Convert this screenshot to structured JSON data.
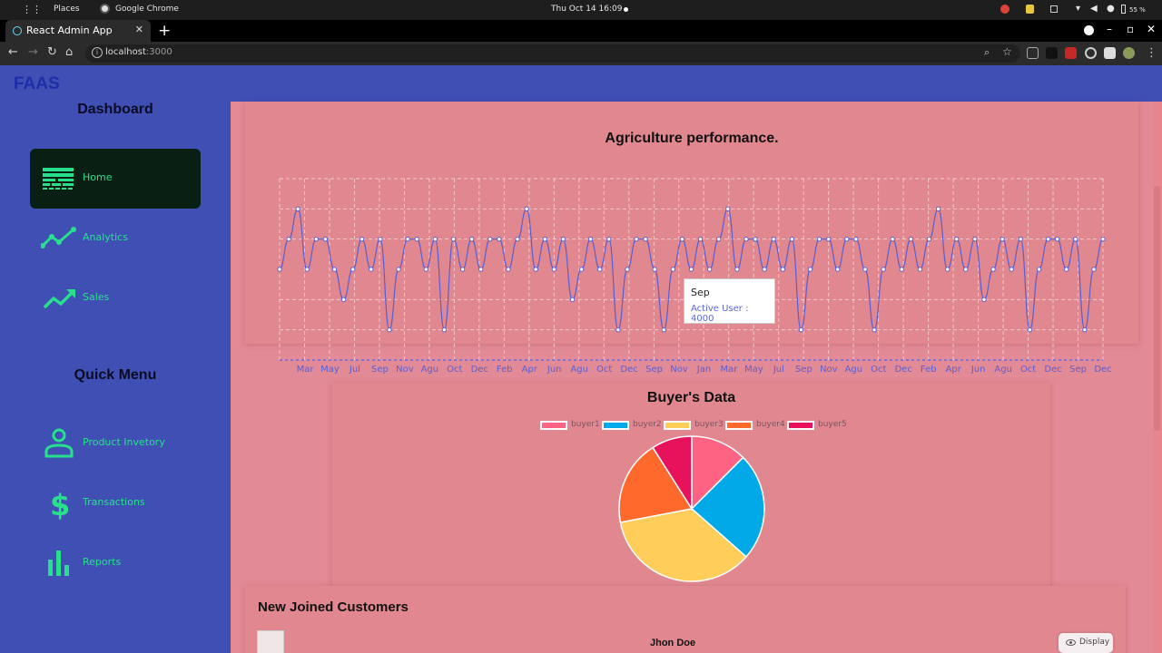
{
  "os_bar": {
    "places": "Places",
    "app_name": "Google Chrome",
    "datetime": "Thu Oct 14  16:09",
    "battery": "55 %"
  },
  "browser": {
    "tab_title": "React Admin App",
    "url_host": "localhost",
    "url_port": ":3000"
  },
  "app": {
    "logo": "FAAS"
  },
  "sidebar": {
    "dashboard_heading": "Dashboard",
    "quick_menu_heading": "Quick Menu",
    "dashboard_items": [
      {
        "label": "Home",
        "icon": "dashboard-icon",
        "active": true
      },
      {
        "label": "Analytics",
        "icon": "timeline-icon",
        "active": false
      },
      {
        "label": "Sales",
        "icon": "trending-up-icon",
        "active": false
      }
    ],
    "quick_items": [
      {
        "label": "Product Invetory",
        "icon": "person-icon"
      },
      {
        "label": "Transactions",
        "icon": "dollar-icon"
      },
      {
        "label": "Reports",
        "icon": "bar-chart-icon"
      }
    ]
  },
  "colors": {
    "sidebar_bg": "#3f4fb4",
    "accent_green": "#28e08c",
    "line_color": "#5b5fd0",
    "page_bg": "#e28a95"
  },
  "chart_data": [
    {
      "type": "line",
      "title": "Agriculture performance.",
      "series": [
        {
          "name": "Active User",
          "values": [
            3000,
            4000,
            5000,
            3000,
            4000,
            4000,
            3000,
            2000,
            3000,
            4000,
            3000,
            4000,
            1000,
            3000,
            4000,
            4000,
            3000,
            4000,
            1000,
            4000,
            3000,
            4000,
            3000,
            4000,
            4000,
            3000,
            4000,
            5000,
            3000,
            4000,
            3000,
            4000,
            2000,
            3000,
            4000,
            3000,
            4000,
            1000,
            3000,
            4000,
            4000,
            3000,
            1000,
            3000,
            4000,
            3000,
            4000,
            3000,
            4000,
            5000,
            3000,
            4000,
            4000,
            3000,
            4000,
            3000,
            4000,
            1000,
            3000,
            4000,
            4000,
            3000,
            4000,
            4000,
            3000,
            1000,
            3000,
            4000,
            3000,
            4000,
            3000,
            4000,
            5000,
            3000,
            4000,
            3000,
            4000,
            2000,
            3000,
            4000,
            3000,
            4000,
            1000,
            3000,
            4000,
            4000,
            3000,
            4000,
            1000,
            3000,
            4000
          ]
        }
      ],
      "x_tick_labels": [
        "Mar",
        "May",
        "Jul",
        "Sep",
        "Nov",
        "Agu",
        "Oct",
        "Dec",
        "Feb",
        "Apr",
        "Jun",
        "Agu",
        "Oct",
        "Dec",
        "Sep",
        "Nov",
        "Jan",
        "Mar",
        "May",
        "Jul",
        "Sep",
        "Nov",
        "Agu",
        "Oct",
        "Dec",
        "Feb",
        "Apr",
        "Jun",
        "Agu",
        "Oct",
        "Dec",
        "Sep",
        "Dec"
      ],
      "ylim": [
        0,
        6000
      ],
      "grid": true,
      "tooltip": {
        "label": "Sep",
        "value_text": "Active User : 4000"
      }
    },
    {
      "type": "pie",
      "title": "Buyer's Data",
      "legend_position": "top",
      "slices": [
        {
          "name": "buyer1",
          "value": 12.5,
          "color": "#ff6384"
        },
        {
          "name": "buyer2",
          "value": 24,
          "color": "#01a9e8"
        },
        {
          "name": "buyer3",
          "value": 35.5,
          "color": "#ffcd5a"
        },
        {
          "name": "buyer4",
          "value": 19,
          "color": "#ff6a2c"
        },
        {
          "name": "buyer5",
          "value": 9,
          "color": "#e8115b"
        }
      ]
    }
  ],
  "customers": {
    "title": "New Joined Customers",
    "rows": [
      {
        "name": "Jhon Doe",
        "action": "Display"
      }
    ]
  }
}
